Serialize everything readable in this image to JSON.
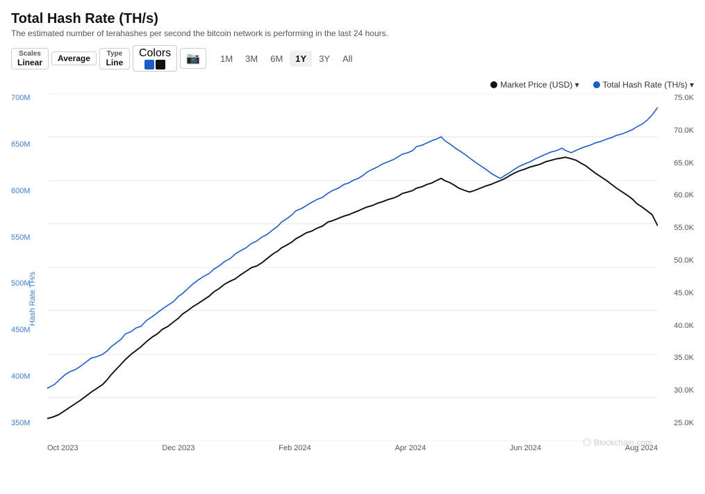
{
  "page": {
    "title": "Total Hash Rate (TH/s)",
    "subtitle": "The estimated number of terahashes per second the bitcoin network is performing in the last 24 hours."
  },
  "toolbar": {
    "scales_label": "Scales",
    "scales_value": "Linear",
    "average_label": "Average",
    "type_label": "Type",
    "type_value": "Line",
    "colors_label": "Colors",
    "color1": "#1a5dc7",
    "color2": "#111111",
    "camera_icon": "📷",
    "time_buttons": [
      "1M",
      "3M",
      "6M",
      "1Y",
      "3Y",
      "All"
    ],
    "active_time": "1Y"
  },
  "legend": [
    {
      "label": "Market Price (USD)",
      "color": "#111111"
    },
    {
      "label": "Total Hash Rate (TH/s)",
      "color": "#1a5dc7"
    }
  ],
  "y_axis_left": [
    "700M",
    "650M",
    "600M",
    "550M",
    "500M",
    "450M",
    "400M",
    "350M"
  ],
  "y_axis_right": [
    "75.0K",
    "70.0K",
    "65.0K",
    "60.0K",
    "55.0K",
    "50.0K",
    "45.0K",
    "40.0K",
    "35.0K",
    "30.0K",
    "25.0K"
  ],
  "x_axis": [
    "Oct 2023",
    "Dec 2023",
    "Feb 2024",
    "Apr 2024",
    "Jun 2024",
    "Aug 2024"
  ],
  "axis_title": "Hash Rate TH/s",
  "watermark": "Blockchain.com"
}
